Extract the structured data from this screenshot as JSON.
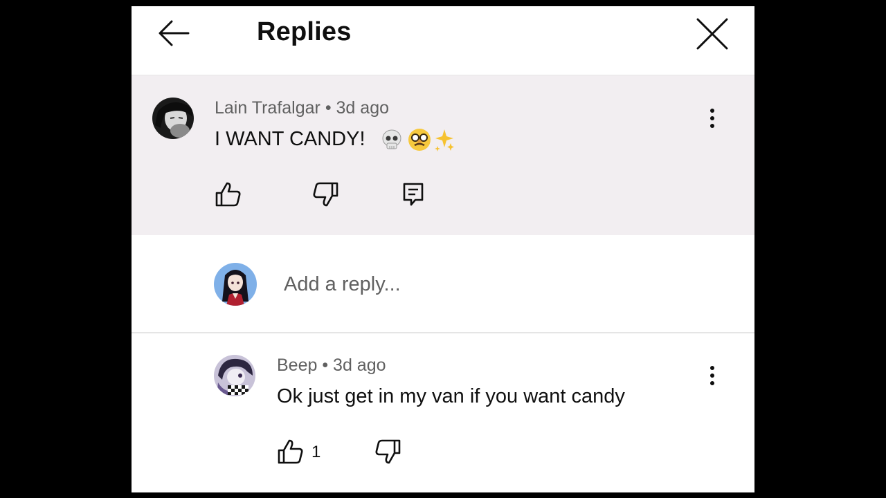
{
  "header": {
    "title": "Replies",
    "back_icon": "arrow-left-icon",
    "close_icon": "close-icon"
  },
  "parent_comment": {
    "author": "Lain Trafalgar",
    "separator": " • ",
    "time": "3d ago",
    "text": "I WANT CANDY!",
    "emojis": [
      "skull-emoji",
      "disguised-face-emoji",
      "sparkles-emoji"
    ],
    "actions": [
      "like-icon",
      "dislike-icon",
      "reply-icon"
    ],
    "menu_icon": "more-vertical-icon"
  },
  "reply_box": {
    "placeholder": "Add a reply..."
  },
  "replies": [
    {
      "author": "Beep",
      "separator": " • ",
      "time": "3d ago",
      "text": "Ok just get in my van if you want candy",
      "like_count": "1",
      "menu_icon": "more-vertical-icon"
    }
  ],
  "colors": {
    "highlight_bg": "#f2eef1",
    "text_primary": "#0f0f0f",
    "text_secondary": "#606060",
    "divider": "#e5e5e5"
  }
}
